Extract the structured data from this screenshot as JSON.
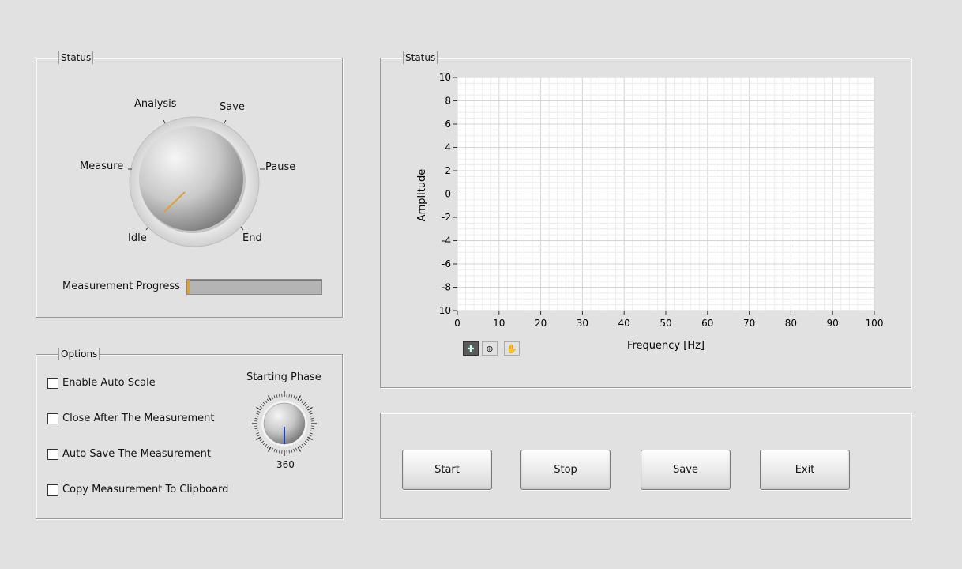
{
  "status_panel": {
    "title": "Status",
    "knob_positions": [
      "Idle",
      "Measure",
      "Analysis",
      "Save",
      "Pause",
      "End"
    ],
    "selected_position": "Idle",
    "progress_label": "Measurement Progress",
    "progress_fraction": 0.02
  },
  "options_panel": {
    "title": "Options",
    "checkboxes": [
      {
        "label": "Enable Auto Scale",
        "checked": false
      },
      {
        "label": "Close After The Measurement",
        "checked": false
      },
      {
        "label": "Auto Save The Measurement",
        "checked": false
      },
      {
        "label": "Copy Measurement To Clipboard",
        "checked": false
      }
    ],
    "starting_phase": {
      "label": "Starting Phase",
      "value": "360"
    }
  },
  "graph_panel": {
    "title": "Status"
  },
  "chart_data": {
    "type": "line",
    "title": "",
    "xlabel": "Frequency [Hz]",
    "ylabel": "Amplitude",
    "xlim": [
      0,
      100
    ],
    "ylim": [
      -10,
      10
    ],
    "x_ticks": [
      "0",
      "10",
      "20",
      "30",
      "40",
      "50",
      "60",
      "70",
      "80",
      "90",
      "100"
    ],
    "y_ticks": [
      "10",
      "8",
      "6",
      "4",
      "2",
      "0",
      "-2",
      "-4",
      "-6",
      "-8",
      "-10"
    ],
    "grid": true,
    "series": []
  },
  "graph_tools": [
    "crosshair-icon",
    "zoom-icon",
    "pan-hand-icon"
  ],
  "buttons": {
    "start": "Start",
    "stop": "Stop",
    "save": "Save",
    "exit": "Exit"
  },
  "colors": {
    "background": "#e1e1e1",
    "progress_fill": "#e0a030",
    "knob_needle": "#e0a030",
    "phase_needle": "#1b3fc8"
  }
}
